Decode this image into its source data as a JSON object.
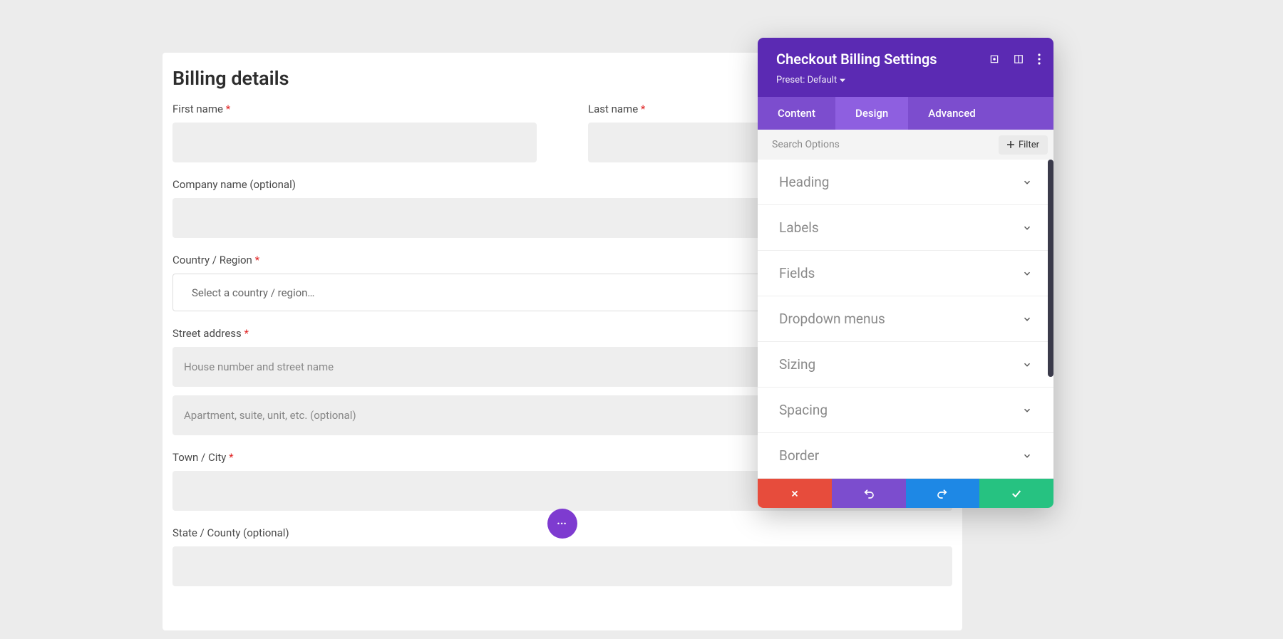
{
  "form": {
    "heading": "Billing details",
    "first_name_label": "First name",
    "last_name_label": "Last name",
    "company_label": "Company name (optional)",
    "country_label": "Country / Region",
    "country_placeholder": "Select a country / region…",
    "street_label": "Street address",
    "street_placeholder1": "House number and street name",
    "street_placeholder2": "Apartment, suite, unit, etc. (optional)",
    "town_label": "Town / City",
    "state_label": "State / County (optional)"
  },
  "panel": {
    "title": "Checkout Billing Settings",
    "preset_label": "Preset: Default",
    "tabs": {
      "content": "Content",
      "design": "Design",
      "advanced": "Advanced"
    },
    "search_placeholder": "Search Options",
    "filter_label": "Filter",
    "sections": {
      "heading": "Heading",
      "labels": "Labels",
      "fields": "Fields",
      "dropdown": "Dropdown menus",
      "sizing": "Sizing",
      "spacing": "Spacing",
      "border": "Border"
    }
  }
}
